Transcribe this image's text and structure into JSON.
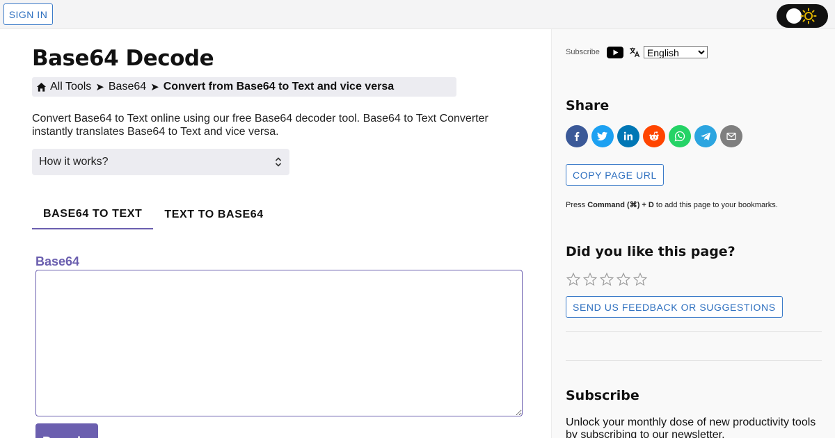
{
  "header": {
    "signin_label": "SIGN IN",
    "theme_toggle": "sun-icon"
  },
  "main": {
    "title": "Base64 Decode",
    "breadcrumb": {
      "home_icon": "home-icon",
      "items": [
        "All Tools",
        "Base64",
        "Convert from Base64 to Text and vice versa"
      ],
      "separator": "➤"
    },
    "intro": "Convert Base64 to Text online using our free Base64 decoder tool. Base64 to Text Converter instantly translates Base64 to Text and vice versa.",
    "how_it_works": "How it works?",
    "tabs": [
      {
        "label": "BASE64 TO TEXT",
        "active": true
      },
      {
        "label": "TEXT TO BASE64",
        "active": false
      }
    ],
    "input_label": "Base64",
    "input_value": "",
    "decode_label": "Decode"
  },
  "sidebar": {
    "subscribe_label": "Subscribe",
    "language_selected": "English",
    "share_heading": "Share",
    "share_icons": [
      "facebook-icon",
      "twitter-icon",
      "linkedin-icon",
      "reddit-icon",
      "whatsapp-icon",
      "telegram-icon",
      "email-icon"
    ],
    "share_colors": [
      "#3b5998",
      "#1da1f2",
      "#0077b5",
      "#ff4500",
      "#25d366",
      "#2ca5e0",
      "#7f7f7f"
    ],
    "copy_url_label": "COPY PAGE URL",
    "bookmark_prefix": "Press ",
    "bookmark_shortcut": "Command (⌘) + D",
    "bookmark_suffix": " to add this page to your bookmarks.",
    "rating_heading": "Did you like this page?",
    "rating_stars": 5,
    "feedback_label": "SEND US FEEDBACK OR SUGGESTIONS",
    "subscribe_heading": "Subscribe",
    "subscribe_text": "Unlock your monthly dose of new productivity tools by subscribing to our newsletter."
  },
  "colors": {
    "accent": "#6b5faf",
    "link_blue": "#2d6fbf"
  }
}
